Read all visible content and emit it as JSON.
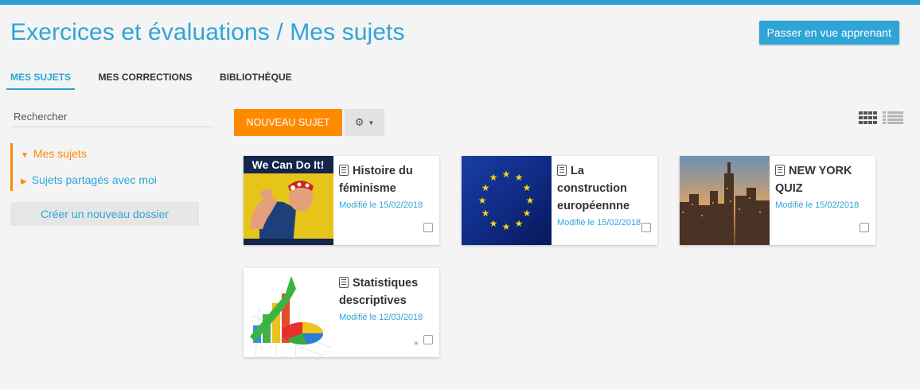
{
  "header": {
    "title": "Exercices et évaluations / Mes sujets",
    "switch_label": "Passer en vue apprenant"
  },
  "tabs": [
    {
      "label": "MES SUJETS",
      "active": true
    },
    {
      "label": "MES CORRECTIONS",
      "active": false
    },
    {
      "label": "BIBLIOTHÈQUE",
      "active": false
    }
  ],
  "sidebar": {
    "search_placeholder": "Rechercher",
    "folders": [
      {
        "label": "Mes sujets",
        "expanded": true
      },
      {
        "label": "Sujets partagés avec moi",
        "expanded": false
      }
    ],
    "new_folder_label": "Créer un nouveau dossier"
  },
  "toolbar": {
    "new_subject_label": "NOUVEAU SUJET",
    "settings_icon": "gear-icon",
    "view_icons": [
      "grid-view-icon",
      "list-view-icon"
    ]
  },
  "cards": [
    {
      "title": "Histoire du féminisme",
      "date": "Modifié le 15/02/2018",
      "thumb_caption": "We Can Do It!"
    },
    {
      "title": "La construction européennne",
      "date": "Modifié le 15/02/2018"
    },
    {
      "title": "NEW YORK QUIZ",
      "date": "Modifié le 15/02/2018"
    },
    {
      "title": "Statistiques descriptives",
      "date": "Modifié le 12/03/2018",
      "shared": true
    }
  ],
  "colors": {
    "accent": "#2fa4d7",
    "orange": "#ff8a00",
    "background": "#f4f4f4"
  }
}
